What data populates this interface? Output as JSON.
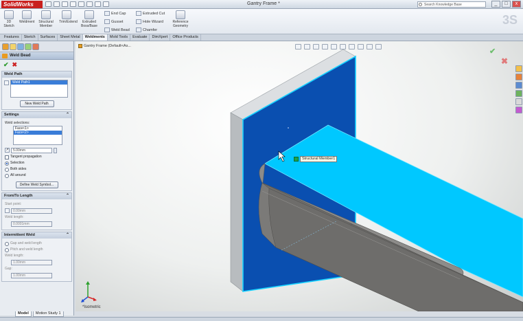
{
  "app": {
    "logo": "SolidWorks",
    "doc_title": "Gantry Frame *"
  },
  "search": {
    "placeholder": "Search Knowledge Base"
  },
  "window_controls": {
    "minimize": "_",
    "maximize": "□",
    "close": "x"
  },
  "ribbon": {
    "large": [
      {
        "label": "3D Sketch"
      },
      {
        "label": "Weldment"
      },
      {
        "label": "Structural Member"
      },
      {
        "label": "Trim/Extend"
      },
      {
        "label": "Extruded Boss/Base"
      }
    ],
    "small": [
      {
        "label": "End Cap"
      },
      {
        "label": "Gusset"
      },
      {
        "label": "Weld Bead"
      },
      {
        "label": "Extruded Cut"
      },
      {
        "label": "Hole Wizard"
      },
      {
        "label": "Chamfer"
      },
      {
        "label": "Reference Geometry"
      }
    ]
  },
  "tabs": [
    "Features",
    "Sketch",
    "Surfaces",
    "Sheet Metal",
    "Weldments",
    "Mold Tools",
    "Evaluate",
    "DimXpert",
    "Office Products"
  ],
  "active_tab": "Weldments",
  "property_manager": {
    "title": "Weld Bead",
    "weld_path": {
      "header": "Weld Path",
      "items": [
        "Weld Path1"
      ],
      "button": "New Weld Path"
    },
    "settings": {
      "header": "Settings",
      "selections_label": "Weld selections:",
      "selections": [
        "Face<1>",
        "Face<2>"
      ],
      "size_value": "5.00mm",
      "tangent_propagation": "Tangent propagation",
      "selection": "Selection",
      "both_sides": "Both sides",
      "all_around": "All around",
      "define_symbol": "Define Weld Symbol..."
    },
    "from_to_length": {
      "header": "From/To Length",
      "start_point_label": "Start point:",
      "start_point_value": "0.00mm",
      "weld_length_label": "Weld length:",
      "weld_length_value": "0.0001mm"
    },
    "intermittent_weld": {
      "header": "Intermittent Weld",
      "gap_and_weld": "Gap and weld length",
      "pitch_and_weld": "Pitch and weld length",
      "weld_length_label": "Weld length:",
      "weld_length_value": "1.00mm",
      "gap_label": "Gap:",
      "gap_value": "1.00mm"
    }
  },
  "viewport": {
    "tree_label": "Gantry Frame  (Default<As...",
    "tooltip": "Structural Member1",
    "view_label": "*Isometric"
  },
  "bottom_tabs": [
    "Model",
    "Motion Study 1"
  ],
  "colors": {
    "selection_face": "#00c8ff",
    "plate_face": "#0a4fb0",
    "member_gray": "#6e6d6b",
    "logo_red": "#c9201e"
  }
}
